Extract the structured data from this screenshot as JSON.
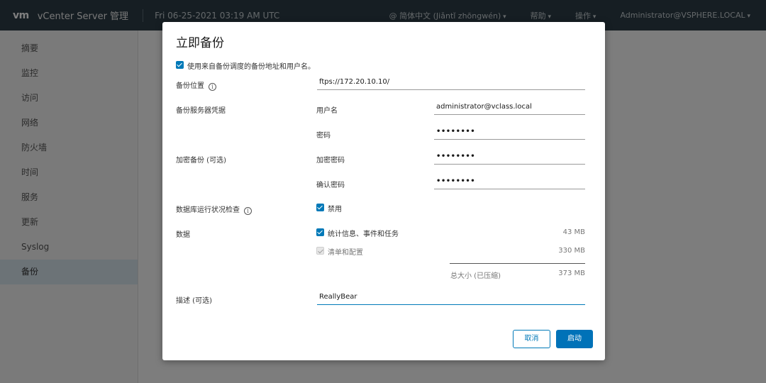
{
  "topbar": {
    "logo": "vm",
    "app_title": "vCenter Server 管理",
    "datetime": "Fri 06-25-2021 03:19 AM UTC",
    "language": "@ 简体中文 (Jiǎntǐ zhōngwén)",
    "help": "帮助",
    "actions": "操作",
    "user": "Administrator@VSPHERE.LOCAL"
  },
  "sidebar": {
    "items": [
      "摘要",
      "监控",
      "访问",
      "网络",
      "防火墙",
      "时间",
      "服务",
      "更新",
      "Syslog",
      "备份"
    ],
    "active_index": 9
  },
  "modal": {
    "title": "立即备份",
    "use_schedule_label": "使用来自备份调度的备份地址和用户名。",
    "location_label": "备份位置",
    "location_value": "ftps://172.20.10.10/",
    "credentials_label": "备份服务器凭据",
    "username_label": "用户名",
    "username_value": "administrator@vclass.local",
    "password_label": "密码",
    "password_value": "••••••••",
    "encrypt_label": "加密备份 (可选)",
    "encrypt_password_label": "加密密码",
    "encrypt_password_value": "••••••••",
    "confirm_password_label": "确认密码",
    "confirm_password_value": "••••••••",
    "db_check_label": "数据库运行状况检查",
    "db_check_option": "禁用",
    "data_label": "数据",
    "stats_label": "统计信息、事件和任务",
    "stats_size": "43 MB",
    "inventory_label": "清单和配置",
    "inventory_size": "330 MB",
    "total_label": "总大小 (已压缩)",
    "total_size": "373 MB",
    "description_label": "描述 (可选)",
    "description_value": "ReallyBear",
    "cancel_button": "取消",
    "start_button": "启动"
  },
  "colors": {
    "accent": "#0079b8",
    "topbar": "#2c3c46"
  }
}
